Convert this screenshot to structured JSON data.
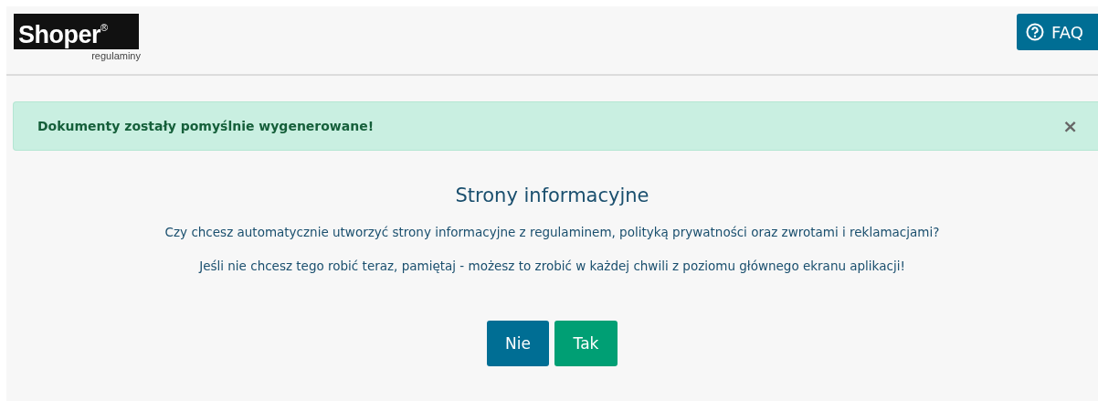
{
  "header": {
    "logo": "Shoper$^{®}$",
    "logo_subtitle": "regulaminy",
    "faq_button": "FAQ"
  },
  "alert": {
    "message": "Dokumenty zostały pomyślnie wygenerowane!",
    "close": "×"
  },
  "dialog": {
    "title": "Strony informacyjne",
    "paragraphs": [
      "Czy chcesz automatycznie utworzyć strony informacyjne z regulaminem, polityką prywatności oraz zwrotami i reklamacjami?",
      "Jeśli nie chcesz tego robić teraz, pamiętaj - możesz to zrobić w każdej chwili z poziomu głównego ekranu aplikacji!"
    ],
    "buttons": [
      {
        "label": "Nie",
        "kind": "secondary"
      },
      {
        "label": "Tak",
        "kind": "primary"
      }
    ]
  }
}
